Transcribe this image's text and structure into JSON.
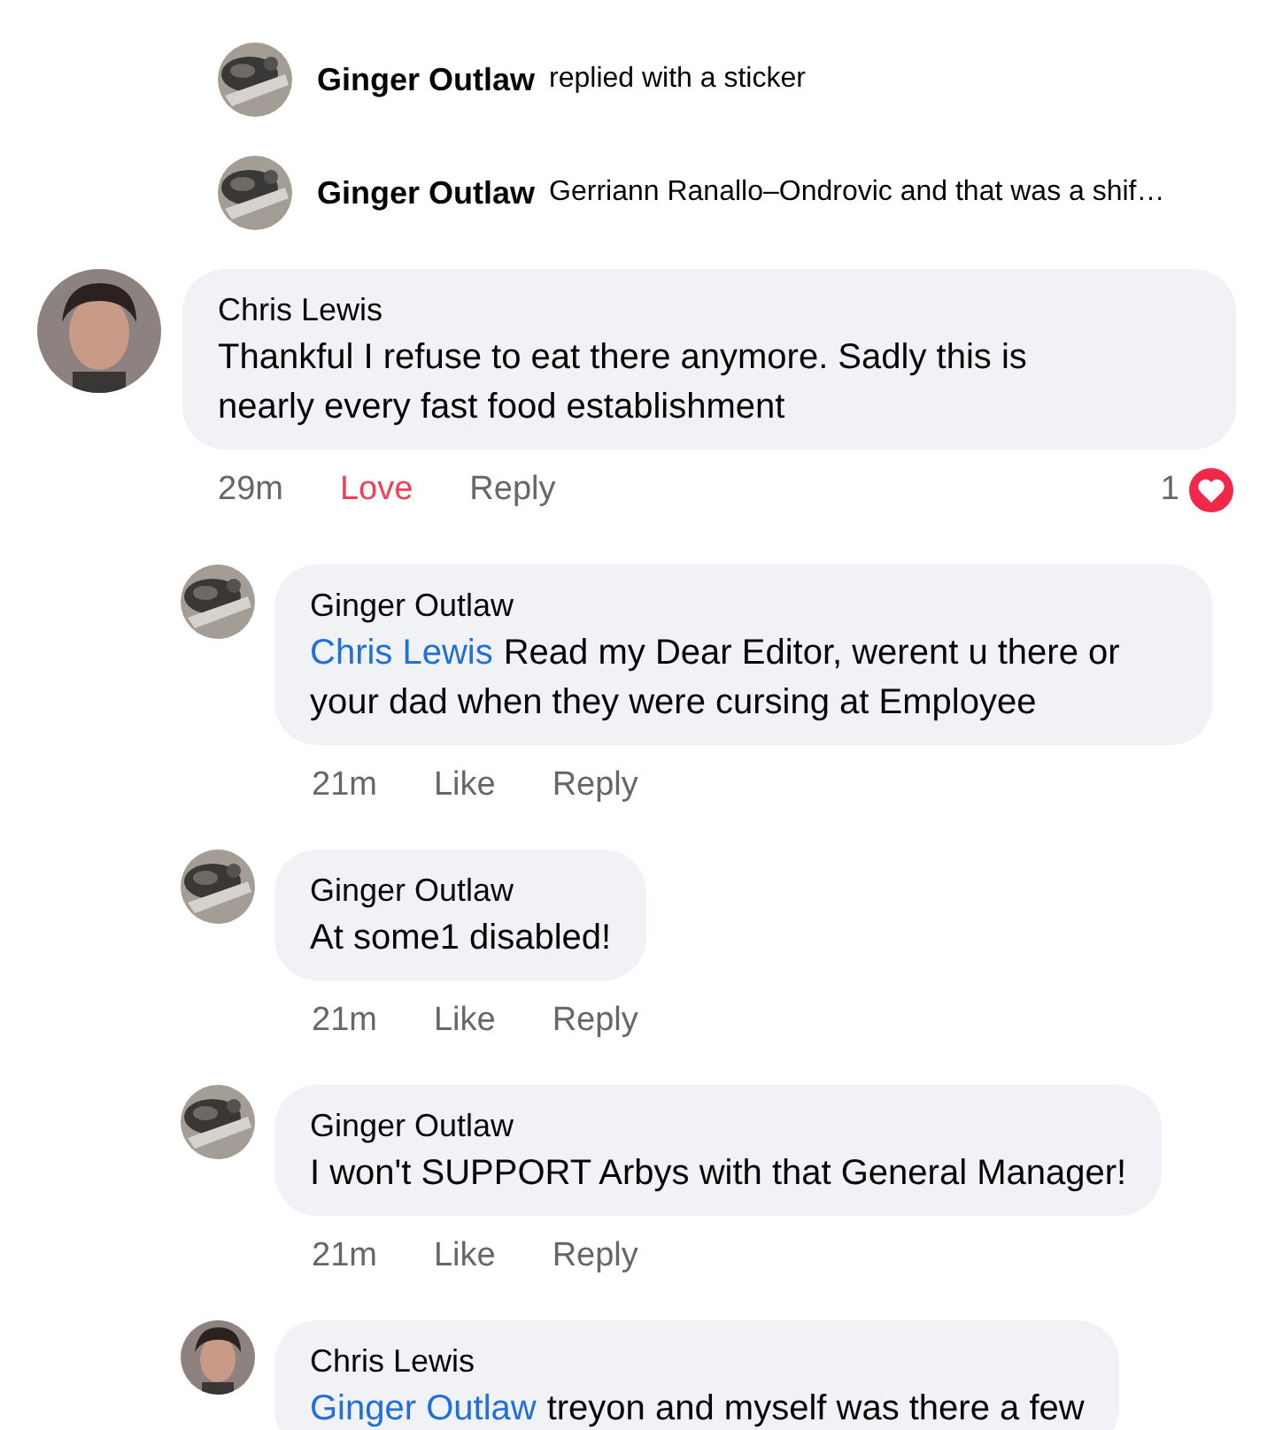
{
  "thread_summaries": [
    {
      "author": "Ginger Outlaw",
      "text": "replied with a sticker"
    },
    {
      "author": "Ginger Outlaw",
      "text": "Gerriann Ranallo–Ondrovic and that was a shif…"
    }
  ],
  "comments": [
    {
      "author": "Chris Lewis",
      "kind": "person",
      "text": "Thankful I refuse to eat there anymore. Sadly this is nearly every fast food establishment",
      "time": "29m",
      "reaction_label": "Love",
      "reacted": true,
      "reply_label": "Reply",
      "reaction_count": "1",
      "replies": [
        {
          "author": "Ginger Outlaw",
          "kind": "rock",
          "mention": "Chris Lewis",
          "text": "Read my Dear Editor, werent u there or your dad when they were cursing at Employee",
          "time": "21m",
          "reaction_label": "Like",
          "reacted": false,
          "reply_label": "Reply"
        },
        {
          "author": "Ginger Outlaw",
          "kind": "rock",
          "text": "At some1 disabled!",
          "time": "21m",
          "reaction_label": "Like",
          "reacted": false,
          "reply_label": "Reply"
        },
        {
          "author": "Ginger Outlaw",
          "kind": "rock",
          "text": "I won't SUPPORT Arbys with that General Manager!",
          "time": "21m",
          "reaction_label": "Like",
          "reacted": false,
          "reply_label": "Reply"
        },
        {
          "author": "Chris Lewis",
          "kind": "person",
          "mention": "Ginger Outlaw",
          "text": "treyon and myself was there a few"
        }
      ]
    }
  ]
}
